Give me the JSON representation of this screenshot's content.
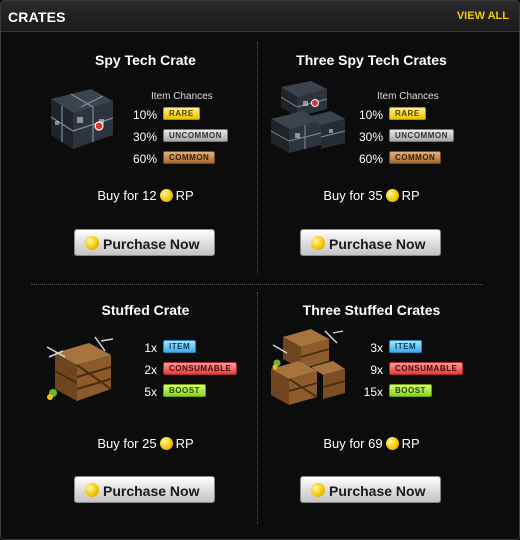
{
  "header": {
    "title": "CRATES",
    "view_all": "VIEW ALL"
  },
  "cards": [
    {
      "title": "Spy Tech Crate",
      "chances_label": "Item Chances",
      "rows": [
        {
          "value": "10%",
          "badge": "RARE"
        },
        {
          "value": "30%",
          "badge": "UNCOMMON"
        },
        {
          "value": "60%",
          "badge": "COMMON"
        }
      ],
      "buy_prefix": "Buy for 12",
      "currency": "RP",
      "button": "Purchase Now"
    },
    {
      "title": "Three Spy Tech Crates",
      "chances_label": "Item Chances",
      "rows": [
        {
          "value": "10%",
          "badge": "RARE"
        },
        {
          "value": "30%",
          "badge": "UNCOMMON"
        },
        {
          "value": "60%",
          "badge": "COMMON"
        }
      ],
      "buy_prefix": "Buy for 35",
      "currency": "RP",
      "button": "Purchase Now"
    },
    {
      "title": "Stuffed Crate",
      "rows": [
        {
          "value": "1x",
          "badge": "ITEM"
        },
        {
          "value": "2x",
          "badge": "CONSUMABLE"
        },
        {
          "value": "5x",
          "badge": "BOOST"
        }
      ],
      "buy_prefix": "Buy for 25",
      "currency": "RP",
      "button": "Purchase Now"
    },
    {
      "title": "Three Stuffed Crates",
      "rows": [
        {
          "value": "3x",
          "badge": "ITEM"
        },
        {
          "value": "9x",
          "badge": "CONSUMABLE"
        },
        {
          "value": "15x",
          "badge": "BOOST"
        }
      ],
      "buy_prefix": "Buy for 69",
      "currency": "RP",
      "button": "Purchase Now"
    }
  ],
  "icons": {
    "currency": "rp-coin-icon",
    "spy_crate": "spy-tech-crate-icon",
    "stuffed_crate": "stuffed-crate-icon"
  },
  "colors": {
    "accent": "#f2c800",
    "background": "#0c0c0c"
  }
}
